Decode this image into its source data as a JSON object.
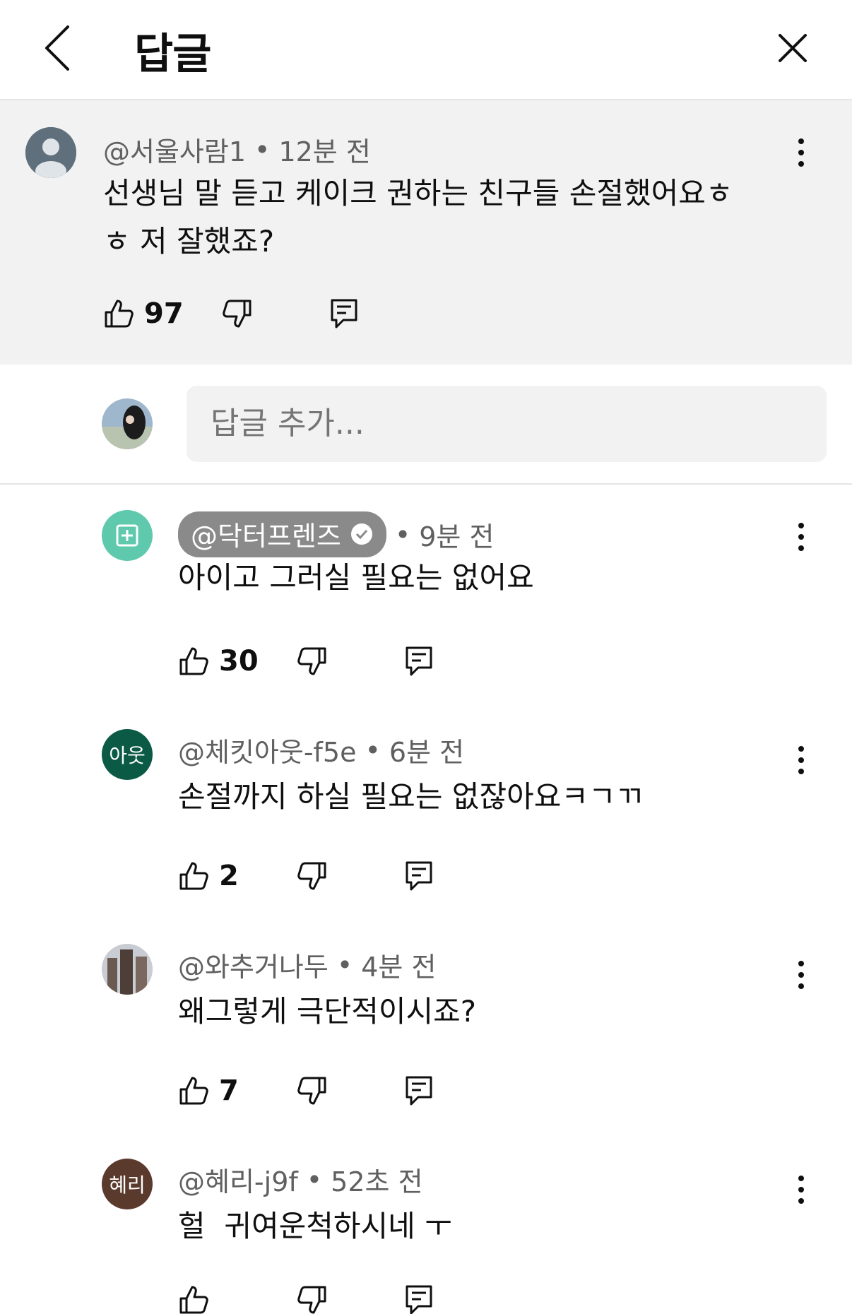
{
  "header": {
    "title": "답글"
  },
  "parent": {
    "handle": "@서울사람1",
    "time": "12분 전",
    "text_line1": "선생님 말 듣고 케이크 권하는 친구들 손절했어요ㅎ",
    "text_line2": "ㅎ 저 잘했죠?",
    "likes": "97"
  },
  "compose": {
    "placeholder": "답글 추가..."
  },
  "replies": [
    {
      "handle": "@닥터프렌즈",
      "time": "9분 전",
      "text": "아이고 그러실 필요는 없어요",
      "likes": "30",
      "avatar_color": "#5fc9ae",
      "verified": true
    },
    {
      "handle": "@체킷아웃-f5e",
      "time": "6분 전",
      "text": "손절까지 하실 필요는 없잖아요ㅋㄱㄲ",
      "likes": "2",
      "avatar_text": "아웃",
      "avatar_color": "#0b5a46"
    },
    {
      "handle": "@와추거나두",
      "time": "4분 전",
      "text": "왜그렇게 극단적이시죠?",
      "likes": "7"
    },
    {
      "handle": "@혜리-j9f",
      "time": "52초 전",
      "text": "헐  귀여운척하시네 ㅜ",
      "likes": "",
      "avatar_text": "혜리",
      "avatar_color": "#5b3a2e"
    }
  ],
  "icons": {
    "back": "chevron-left-icon",
    "close": "close-icon",
    "more": "more-vertical-icon",
    "like": "thumb-up-icon",
    "dislike": "thumb-down-icon",
    "reply": "reply-icon",
    "verified": "verified-check-icon"
  }
}
